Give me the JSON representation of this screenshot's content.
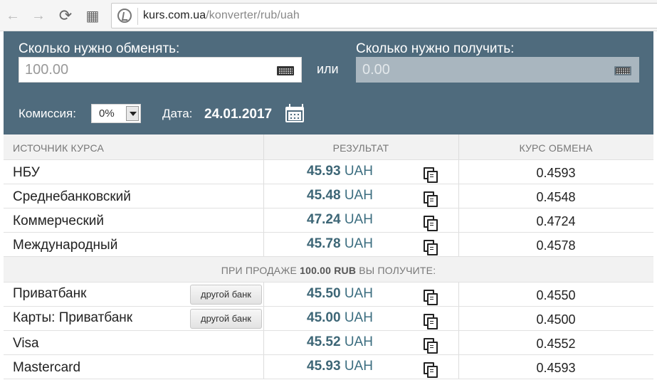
{
  "browser": {
    "back_icon": "←",
    "forward_icon": "→",
    "reload_icon": "⟳",
    "apps_icon": "▦",
    "url_domain": "kurs.com.ua",
    "url_path": "/konverter/rub/uah"
  },
  "converter": {
    "exchange_label": "Сколько нужно обменять:",
    "exchange_value": "100.00",
    "or_label": "или",
    "receive_label": "Сколько нужно получить:",
    "receive_value": "0.00",
    "commission_label": "Комиссия:",
    "commission_value": "0%",
    "date_label": "Дата:",
    "date_value": "24.01.2017"
  },
  "table": {
    "headers": {
      "source": "ИСТОЧНИК КУРСА",
      "result": "РЕЗУЛЬТАТ",
      "rate": "КУРС ОБМЕНА"
    },
    "currency": "UAH",
    "rows": [
      {
        "source": "НБУ",
        "amount": "45.93",
        "rate": "0.4593"
      },
      {
        "source": "Среднебанковский",
        "amount": "45.48",
        "rate": "0.4548"
      },
      {
        "source": "Коммерческий",
        "amount": "47.24",
        "rate": "0.4724"
      },
      {
        "source": "Международный",
        "amount": "45.78",
        "rate": "0.4578"
      }
    ],
    "section": {
      "prefix": "ПРИ ПРОДАЖЕ",
      "amount": "100.00 RUB",
      "suffix": "ВЫ ПОЛУЧИТЕ:"
    },
    "other_bank_label": "другой банк",
    "bank_rows": [
      {
        "source": "Приватбанк",
        "amount": "45.50",
        "rate": "0.4550",
        "has_button": true
      },
      {
        "source": "Карты: Приватбанк",
        "amount": "45.00",
        "rate": "0.4500",
        "has_button": true
      },
      {
        "source": "Visa",
        "amount": "45.52",
        "rate": "0.4552",
        "has_button": false
      },
      {
        "source": "Mastercard",
        "amount": "45.93",
        "rate": "0.4593",
        "has_button": false
      }
    ]
  }
}
